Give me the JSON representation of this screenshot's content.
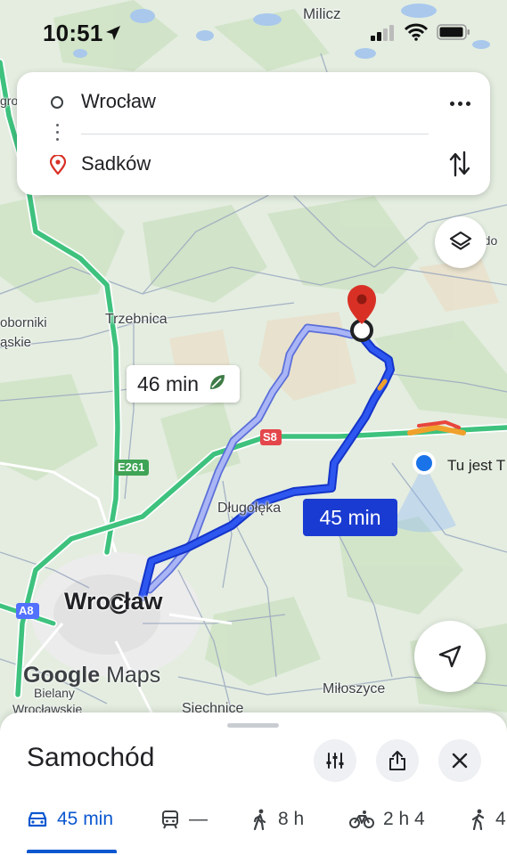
{
  "status_bar": {
    "time": "10:51"
  },
  "search": {
    "origin": "Wrocław",
    "destination": "Sadków"
  },
  "route": {
    "main_duration": "45 min",
    "alt_duration": "46 min"
  },
  "map": {
    "places": {
      "milicz": "Milicz",
      "trzebnica": "Trzebnica",
      "dlugoleka": "Długołęka",
      "wroclaw": "Wrocław",
      "miloszyce": "Miłoszyce",
      "siechnice": "Siechnice",
      "bielany": "Bielany",
      "wroclawskie": "Wrocławskie",
      "oborniki": "oborniki",
      "slaskie": "ąskie",
      "left_fragment": "gro",
      "right_fragment": "rdo"
    },
    "roads": {
      "s8": "S8",
      "e261": "E261",
      "a8": "A8"
    },
    "current_location_label": "Tu jest T"
  },
  "branding": {
    "google": "Google",
    "maps": "Maps"
  },
  "bottom_sheet": {
    "mode_title": "Samochód",
    "tabs": [
      {
        "icon": "car-icon",
        "label": "45 min"
      },
      {
        "icon": "transit-icon",
        "label": "—"
      },
      {
        "icon": "walk-icon",
        "label": "8 h"
      },
      {
        "icon": "bike-icon",
        "label": "2 h 4"
      },
      {
        "icon": "ride-icon",
        "label": "4"
      }
    ]
  },
  "colors": {
    "route_main": "#1a3bd1",
    "route_alt": "#9aa7f2",
    "highway": "#3ec27e",
    "accent": "#0b57d0",
    "destination_pin": "#d93025"
  }
}
